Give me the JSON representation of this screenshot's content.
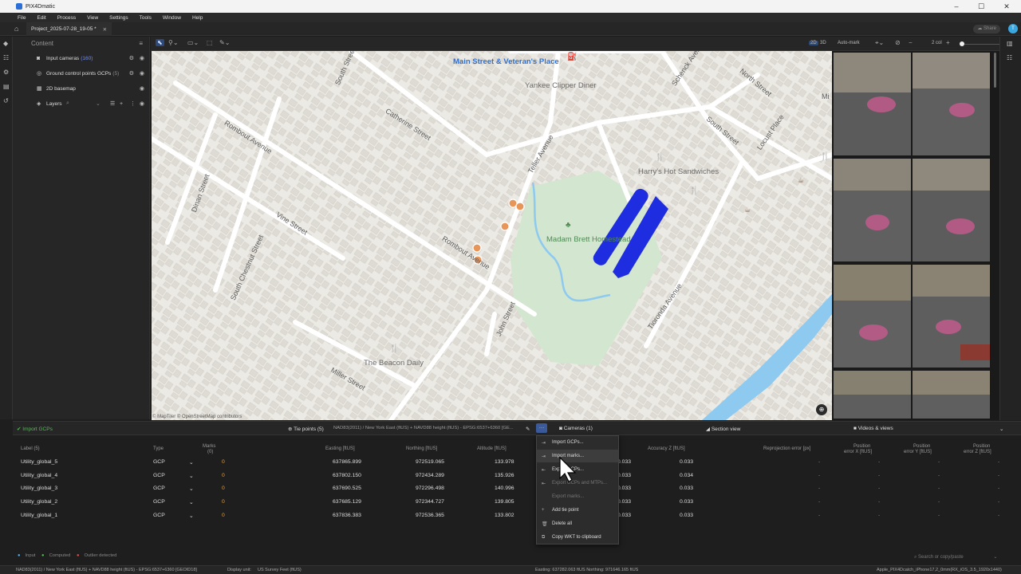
{
  "window": {
    "title": "PIX4Dmatic",
    "minimize": "–",
    "maximize": "☐",
    "close": "✕"
  },
  "menu": [
    "File",
    "Edit",
    "Process",
    "View",
    "Settings",
    "Tools",
    "Window",
    "Help"
  ],
  "tab": {
    "name": "Project_2025-07-28_19-05 *",
    "close": "✕"
  },
  "header": {
    "share": "Share",
    "avatar": "T"
  },
  "left_panel": {
    "title": "Content",
    "items": [
      {
        "label": "Input cameras",
        "count": "(160)",
        "count_color": "#6e8cff"
      },
      {
        "label": "Ground control points GCPs",
        "count": "(5)",
        "count_color": "#888888"
      },
      {
        "label": "2D basemap",
        "count": "",
        "count_color": "#888888"
      },
      {
        "label": "Layers",
        "count": "",
        "count_color": "#888888"
      }
    ]
  },
  "map_toolbar": {
    "view_2d": "2D",
    "view_3d": "3D",
    "auto_mark": "Auto-mark",
    "columns": "2 col"
  },
  "map": {
    "streets": [
      "Main Street & Veteran's Place",
      "Yankee Clipper Diner",
      "South Street",
      "Catherine Street",
      "Rombout Avenue",
      "Dinan Street",
      "Vine Street",
      "South Chestnut Street",
      "Teller Avenue",
      "Rombout Avenue",
      "John Street",
      "Miller Street",
      "Schenck Avenue",
      "North Street",
      "South Street",
      "Locust Place",
      "Harry's Hot Sandwiches",
      "Madam Brett Homestead",
      "Tioronda Avenue",
      "The Beacon Daily",
      "Mi"
    ],
    "attribution": "© MapTiler  © OpenStreetMap contributors"
  },
  "bottom_tabs": {
    "import_gcps": "Import GCPs",
    "tie_points": "Tie points (5)",
    "crs": "NAD83(2011) / New York East (ftUS) + NAVD88 height (ftUS) - EPSG:6537+6360 [GE...",
    "more": "···",
    "cameras": "Cameras (1)",
    "section_view": "Section view",
    "videos_views": "Videos & views"
  },
  "table": {
    "headers": {
      "label": "Label (5)",
      "type": "Type",
      "marks_top": "Marks",
      "marks_bottom": "(0)",
      "easting": "Easting [ftUS]",
      "northing": "Northing [ftUS]",
      "altitude": "Altitude [ftUS]",
      "accuracy_z": "Accuracy Z [ftUS]",
      "reproj": "Reprojection error [px]",
      "pos_x_top": "Position",
      "pos_x_bottom": "error X [ftUS]",
      "pos_y_top": "Position",
      "pos_y_bottom": "error Y [ftUS]",
      "pos_z_top": "Position",
      "pos_z_bottom": "error Z [ftUS]"
    },
    "rows": [
      {
        "label": "Utility_global_5",
        "type": "GCP",
        "marks": "0",
        "easting": "637865.899",
        "northing": "972519.065",
        "altitude": "133.978",
        "acc_xy": "0.033",
        "acc_z": "0.033",
        "dash": "-"
      },
      {
        "label": "Utility_global_4",
        "type": "GCP",
        "marks": "0",
        "easting": "637802.150",
        "northing": "972434.289",
        "altitude": "135.926",
        "acc_xy": "0.033",
        "acc_z": "0.034",
        "dash": "-"
      },
      {
        "label": "Utility_global_3",
        "type": "GCP",
        "marks": "0",
        "easting": "637690.525",
        "northing": "972296.498",
        "altitude": "140.996",
        "acc_xy": "0.033",
        "acc_z": "0.033",
        "dash": "-"
      },
      {
        "label": "Utility_global_2",
        "type": "GCP",
        "marks": "0",
        "easting": "637685.129",
        "northing": "972344.727",
        "altitude": "139.805",
        "acc_xy": "0.033",
        "acc_z": "0.033",
        "dash": "-"
      },
      {
        "label": "Utility_global_1",
        "type": "GCP",
        "marks": "0",
        "easting": "637836.383",
        "northing": "972536.365",
        "altitude": "133.802",
        "acc_xy": "0.033",
        "acc_z": "0.033",
        "dash": "-"
      }
    ]
  },
  "context_menu": [
    {
      "label": "Import GCPs...",
      "icon": "⇥",
      "state": "normal"
    },
    {
      "label": "Import marks...",
      "icon": "⇥",
      "state": "hover"
    },
    {
      "label": "Export GCPs...",
      "icon": "⇤",
      "state": "normal"
    },
    {
      "label": "Export GCPs and MTPs...",
      "icon": "⇤",
      "state": "disabled"
    },
    {
      "label": "Export marks...",
      "icon": "",
      "state": "disabled"
    },
    {
      "label": "Add tie point",
      "icon": "+",
      "state": "normal"
    },
    {
      "label": "Delete all",
      "icon": "🗑",
      "state": "normal"
    },
    {
      "label": "Copy WKT to clipboard",
      "icon": "⧉",
      "state": "normal"
    }
  ],
  "legend": {
    "input": "Input",
    "computed": "Computed",
    "outlier": "Outlier detected"
  },
  "search_placeholder": "Search or copy/paste",
  "status": {
    "crs": "NAD83(2011) / New York East (ftUS) + NAVD88 height (ftUS) - EPSG:6537+6360 [GEOID18]",
    "display_unit_label": "Display unit:",
    "display_unit": "US Survey Feet (ftUS)",
    "coords": "Easting: 637282.063 ftUS   Northing: 971646.165 ftUS",
    "device": "Apple_PIX4Dcatch_iPhone17,2_0mm(RX_iOS_3.5_1920x1440)"
  },
  "colors": {
    "accent": "#2b6fd6",
    "trajectory": "#1f2de0",
    "gcp_marker": "#e8955a",
    "water": "#8ec9f0",
    "park": "#d3e6cf"
  }
}
